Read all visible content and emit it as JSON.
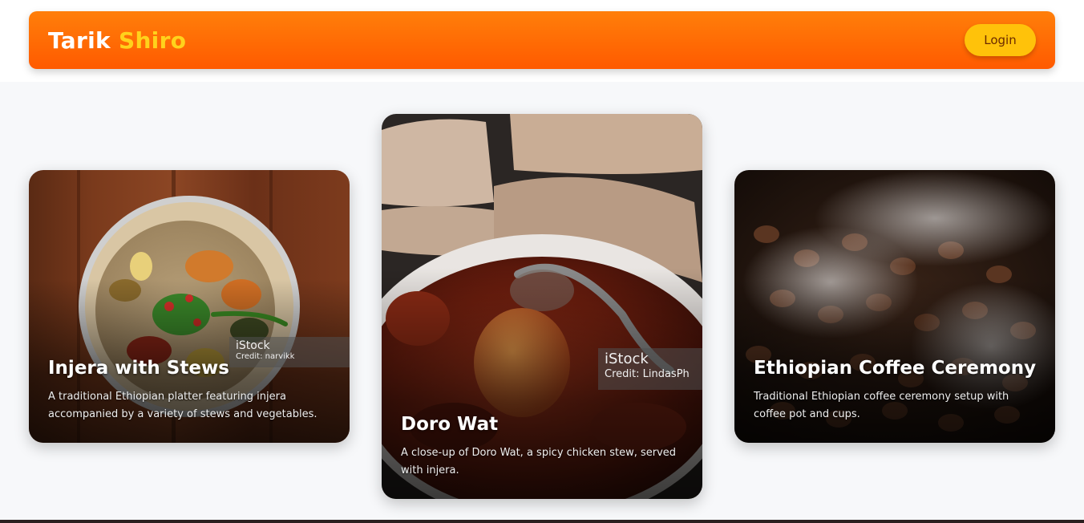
{
  "header": {
    "brand_first": "Tarik",
    "brand_second": "Shiro",
    "login_label": "Login"
  },
  "cards": [
    {
      "title": "Injera with Stews",
      "description": "A traditional Ethiopian platter featuring injera accompanied by a variety of stews and vegetables.",
      "watermark_brand": "iStock",
      "watermark_credit": "Credit: narvikk"
    },
    {
      "title": "Doro Wat",
      "description": "A close-up of Doro Wat, a spicy chicken stew, served with injera.",
      "watermark_brand": "iStock",
      "watermark_credit": "Credit: LindasPh"
    },
    {
      "title": "Ethiopian Coffee Ceremony",
      "description": "Traditional Ethiopian coffee ceremony setup with coffee pot and cups."
    }
  ],
  "colors": {
    "navbar_start": "#ff7f0a",
    "navbar_end": "#ff5a00",
    "brand_accent": "#ffd21c",
    "login_bg": "#ffc20a"
  }
}
